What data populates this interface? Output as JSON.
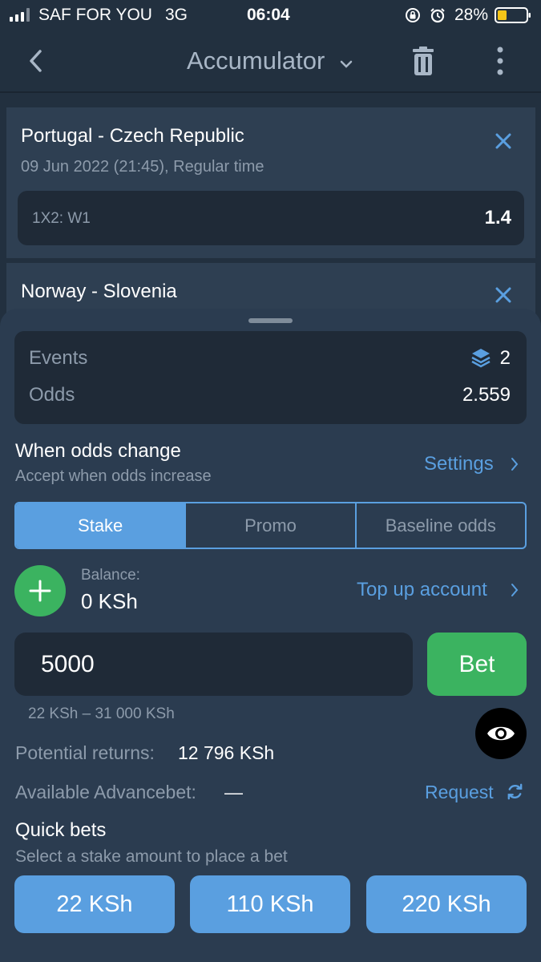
{
  "status_bar": {
    "carrier": "SAF FOR YOU",
    "network": "3G",
    "time": "06:04",
    "battery": "28%"
  },
  "header": {
    "title": "Accumulator"
  },
  "bets": [
    {
      "match": "Portugal - Czech Republic",
      "meta": "09 Jun 2022 (21:45), Regular time",
      "market": "1X2: W1",
      "odd": "1.4"
    },
    {
      "match": "Norway - Slovenia"
    }
  ],
  "summary": {
    "events_label": "Events",
    "events_value": "2",
    "odds_label": "Odds",
    "odds_value": "2.559"
  },
  "odds_change": {
    "title": "When odds change",
    "subtitle": "Accept when odds increase",
    "settings_label": "Settings"
  },
  "tabs": [
    {
      "label": "Stake",
      "active": true
    },
    {
      "label": "Promo",
      "active": false
    },
    {
      "label": "Baseline odds",
      "active": false
    }
  ],
  "balance": {
    "label": "Balance:",
    "value": "0 KSh",
    "topup_label": "Top up account"
  },
  "stake": {
    "value": "5000",
    "bet_label": "Bet",
    "range": "22 KSh – 31 000 KSh"
  },
  "returns": {
    "label": "Potential returns:",
    "value": "12 796 KSh"
  },
  "advancebet": {
    "label": "Available Advancebet:",
    "value": "—",
    "request_label": "Request"
  },
  "quick_bets": {
    "title": "Quick bets",
    "subtitle": "Select a stake amount to place a bet",
    "amounts": [
      "22 KSh",
      "110 KSh",
      "220 KSh"
    ]
  },
  "colors": {
    "background": "#22303f",
    "card": "#2e3f52",
    "sheet": "#2b3c50",
    "field": "#1f2a37",
    "accent_blue": "#5a9fe0",
    "accent_green": "#3bb360",
    "muted_text": "#8d9bab"
  }
}
